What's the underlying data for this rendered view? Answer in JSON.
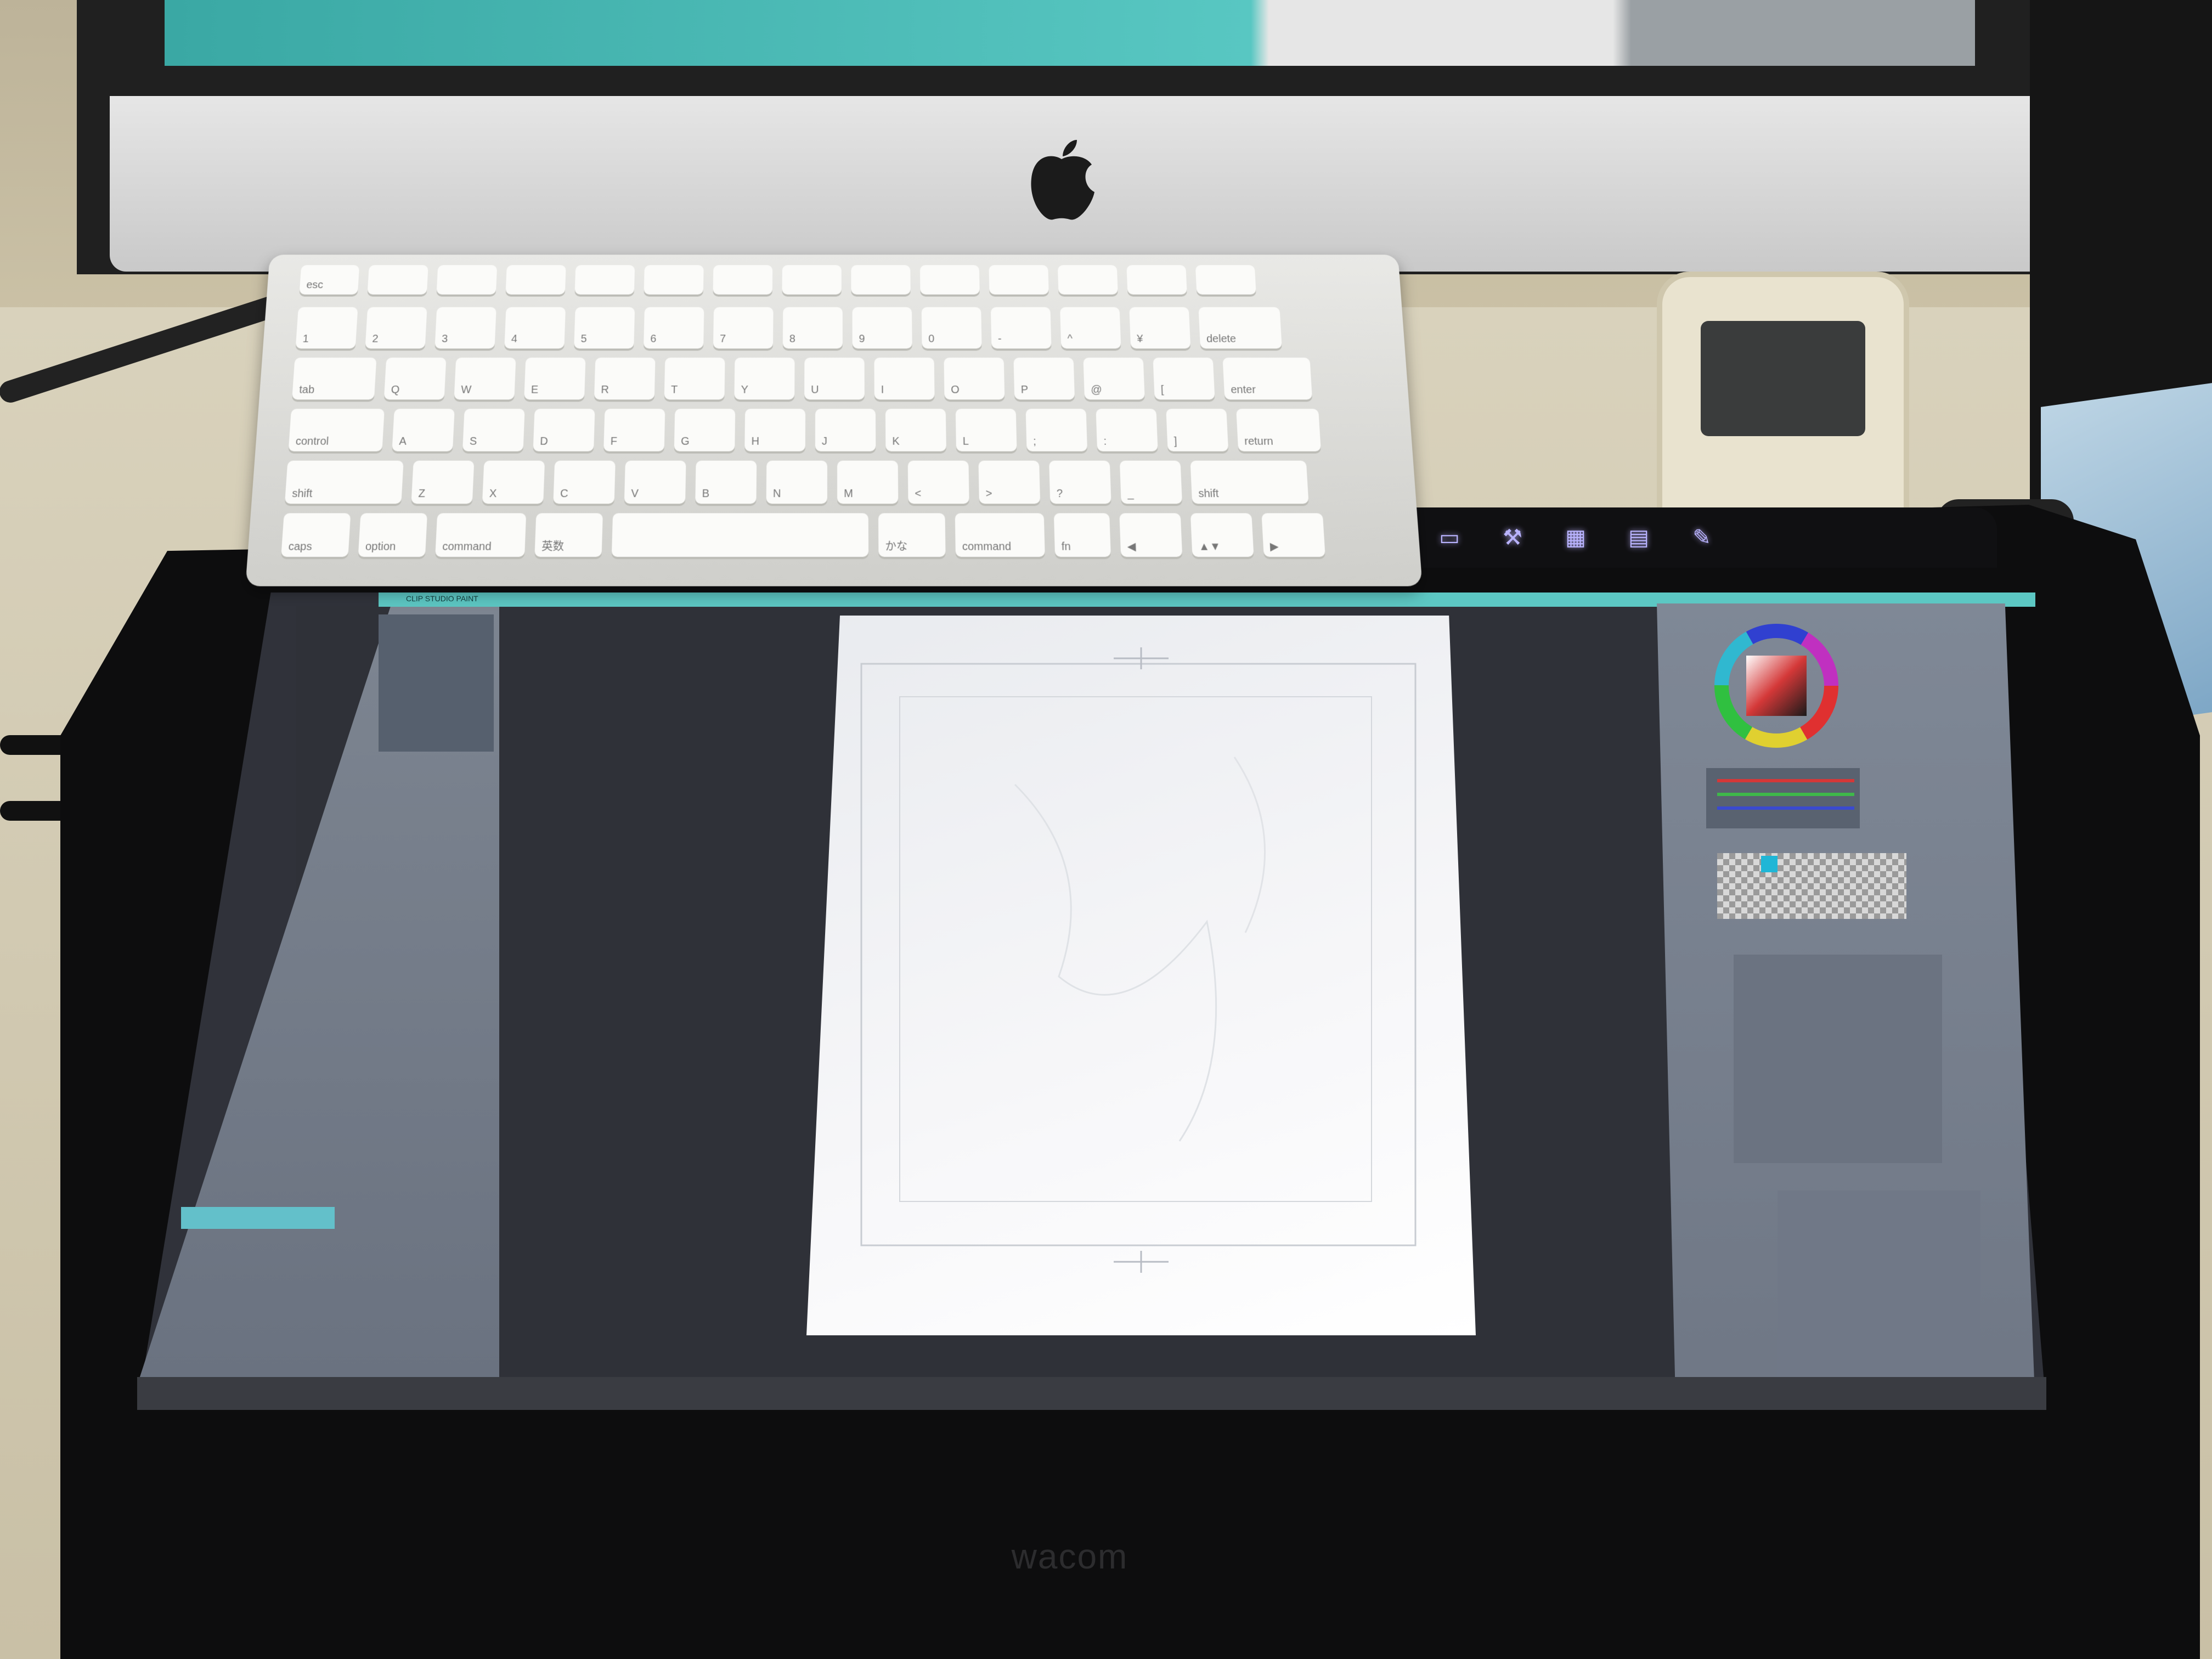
{
  "monitor": {
    "logo": "apple-logo"
  },
  "keyboard": {
    "rows": [
      [
        "esc",
        "",
        "",
        "",
        "",
        "",
        "",
        "",
        "",
        "",
        "",
        "",
        "",
        ""
      ],
      [
        "1",
        "2",
        "3",
        "4",
        "5",
        "6",
        "7",
        "8",
        "9",
        "0",
        "-",
        "^",
        "¥",
        "delete"
      ],
      [
        "tab",
        "Q",
        "W",
        "E",
        "R",
        "T",
        "Y",
        "U",
        "I",
        "O",
        "P",
        "@",
        "[",
        "enter"
      ],
      [
        "control",
        "A",
        "S",
        "D",
        "F",
        "G",
        "H",
        "J",
        "K",
        "L",
        ";",
        ":",
        "]",
        "return"
      ],
      [
        "shift",
        "Z",
        "X",
        "C",
        "V",
        "B",
        "N",
        "M",
        "<",
        ">",
        "?",
        "_",
        "shift"
      ],
      [
        "caps",
        "option",
        "command",
        "英数",
        "",
        "かな",
        "command",
        "fn",
        "◀",
        "▲▼",
        "▶"
      ]
    ]
  },
  "tablet": {
    "brand": "wacom",
    "express_keys": [
      "rectangle-icon",
      "wrench-icon",
      "keyboard-grid-icon",
      "display-icon",
      "pen-settings-icon"
    ]
  },
  "app": {
    "menubar_text": "CLIP STUDIO PAINT",
    "colors": {
      "menubar": "#5cc7c3",
      "panel": "#7d8591",
      "canvas_bg": "#2f3138",
      "paper": "#f5f6f8",
      "accent_cyan": "#1fb6d6"
    }
  }
}
